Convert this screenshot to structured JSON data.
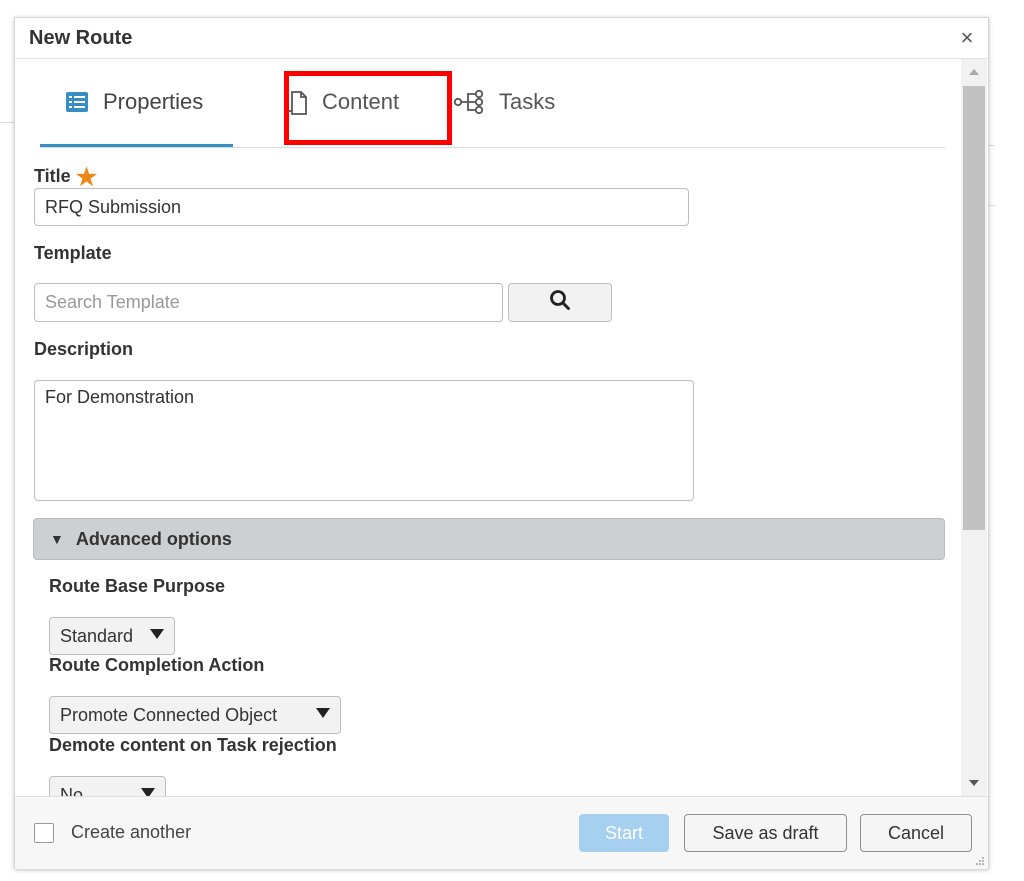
{
  "dialog": {
    "title": "New Route",
    "close_icon": "close-icon"
  },
  "tabs": [
    {
      "label": "Properties",
      "icon": "list-icon",
      "active": true
    },
    {
      "label": "Content",
      "icon": "document-icon",
      "active": false
    },
    {
      "label": "Tasks",
      "icon": "flow-icon",
      "active": false
    }
  ],
  "form": {
    "title_label": "Title",
    "title_value": "RFQ Submission",
    "template_label": "Template",
    "template_placeholder": "Search Template",
    "description_label": "Description",
    "description_value": "For Demonstration",
    "advanced_label": "Advanced options",
    "route_base_purpose_label": "Route Base Purpose",
    "route_base_purpose_value": "Standard",
    "route_completion_label": "Route Completion Action",
    "route_completion_value": "Promote Connected Object",
    "demote_label": "Demote content on Task rejection",
    "demote_value": "No"
  },
  "footer": {
    "create_another_label": "Create another",
    "start_label": "Start",
    "save_draft_label": "Save as draft",
    "cancel_label": "Cancel"
  },
  "colors": {
    "accent": "#368ec4",
    "required_star": "#e98a1b",
    "highlight": "#ff0000",
    "start_button": "#a6d0ef"
  }
}
